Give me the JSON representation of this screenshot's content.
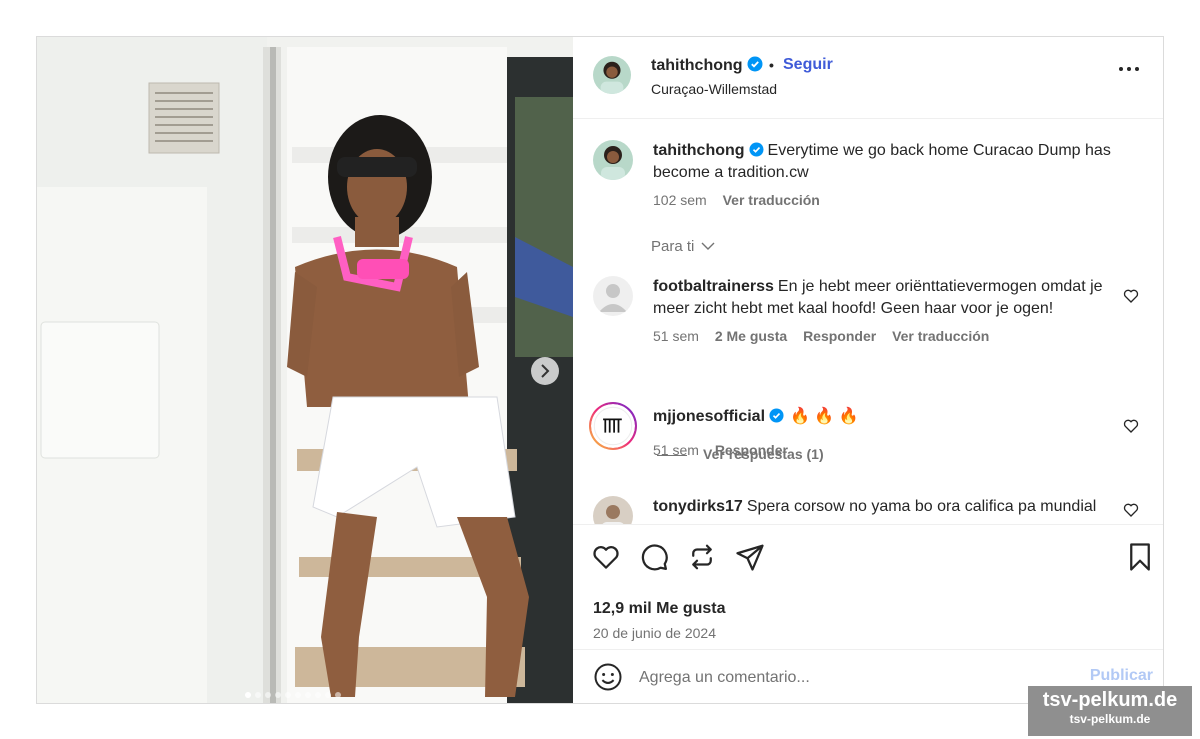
{
  "post": {
    "author": "tahithchong",
    "follow_label": "Seguir",
    "separator": "•",
    "location": "Curaçao-Willemstad",
    "caption": {
      "username": "tahithchong",
      "text": "Everytime we go back home Curacao Dump has become a tradition.cw",
      "age": "102 sem",
      "translate": "Ver traducción"
    },
    "filter_label": "Para ti",
    "comments": [
      {
        "username": "footbaltrainerss",
        "text": "En je hebt meer oriënttatievermogen omdat je meer zicht hebt met kaal hoofd! Geen haar voor je ogen!",
        "age": "51 sem",
        "likes": "2 Me gusta",
        "reply": "Responder",
        "translate": "Ver traducción"
      },
      {
        "username": "mjjonesofficial",
        "text": "🔥 🔥 🔥",
        "age": "51 sem",
        "reply": "Responder",
        "view_replies": "Ver respuestas (1)"
      },
      {
        "username": "tonydirks17",
        "text": "Spera corsow no yama bo ora califica pa mundial"
      }
    ],
    "likes_count": "12,9 mil Me gusta",
    "date": "20 de junio de 2024",
    "comment_placeholder": "Agrega un comentario...",
    "publish_label": "Publicar",
    "carousel": {
      "total": 10,
      "active": 1
    }
  },
  "watermark": {
    "line1": "tsv-pelkum.de",
    "line2": "tsv-pelkum.de"
  },
  "colors": {
    "verified": "#0095f6",
    "link": "#3f5bd8",
    "muted": "#737373",
    "publish_disabled": "#b2c9f5"
  }
}
